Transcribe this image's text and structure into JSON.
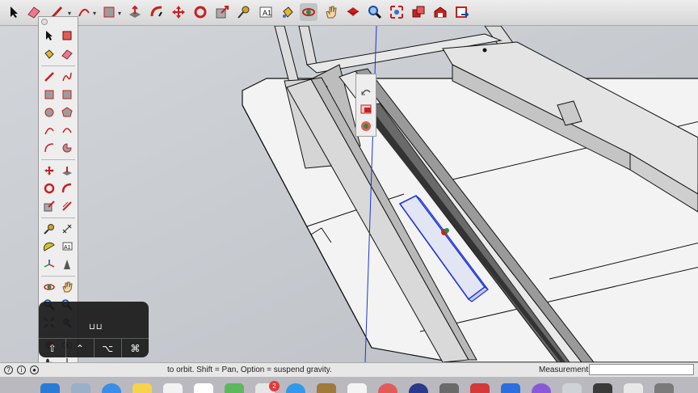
{
  "toolbar": {
    "tools": [
      "select-tool",
      "eraser-tool",
      "line-tool",
      "arc-tool",
      "shape-tool",
      "push-pull-tool",
      "follow-me-tool",
      "move-tool",
      "rotate-tool",
      "scale-tool",
      "tape-measure-tool",
      "text-tool",
      "paint-bucket-tool",
      "orbit-tool",
      "pan-tool",
      "zoom-extents-tool",
      "zoom-tool",
      "zoom-window-tool",
      "components-tool",
      "warehouse-tool",
      "extension-tool"
    ],
    "active_tool": "orbit-tool"
  },
  "status": {
    "text": "to orbit. Shift = Pan, Option = suspend gravity.",
    "measurements_label": "Measurements",
    "measurements_value": ""
  },
  "keyboard_hud": {
    "top_key": "⊔⊔",
    "keys": [
      "⇧",
      "⌃",
      "⌥",
      "⌘"
    ]
  },
  "dock": {
    "badge_count": "2"
  },
  "colors": {
    "axis_blue": "#1e34d6",
    "selection_blue": "#1e34d6",
    "icon_red": "#c8201f",
    "background_gray": "#c9cdd2"
  }
}
